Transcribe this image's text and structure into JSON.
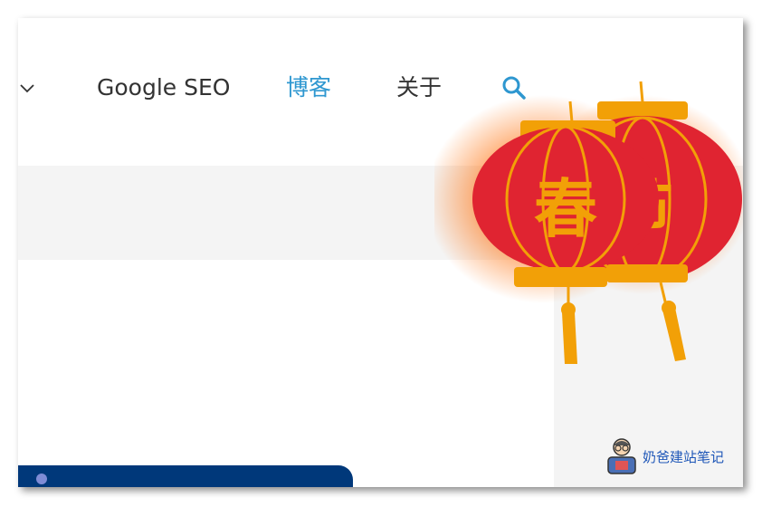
{
  "nav": {
    "items": [
      {
        "label": "Google SEO",
        "active": false
      },
      {
        "label": "博客",
        "active": true
      },
      {
        "label": "关于",
        "active": false
      }
    ]
  },
  "decoration": {
    "lantern_left_char": "春",
    "lantern_right_char": "节"
  },
  "badge": {
    "text": "奶爸建站笔记",
    "icon": "person-with-glasses-icon"
  },
  "icons": {
    "dropdown": "chevron-down-icon",
    "search": "search-icon"
  },
  "colors": {
    "accent": "#2e97d0",
    "nav_text": "#333333",
    "lantern_red": "#e02431",
    "lantern_gold": "#f2a007",
    "card_blue": "#00387a",
    "band_gray": "#f4f4f4",
    "badge_text": "#1f57b8"
  }
}
